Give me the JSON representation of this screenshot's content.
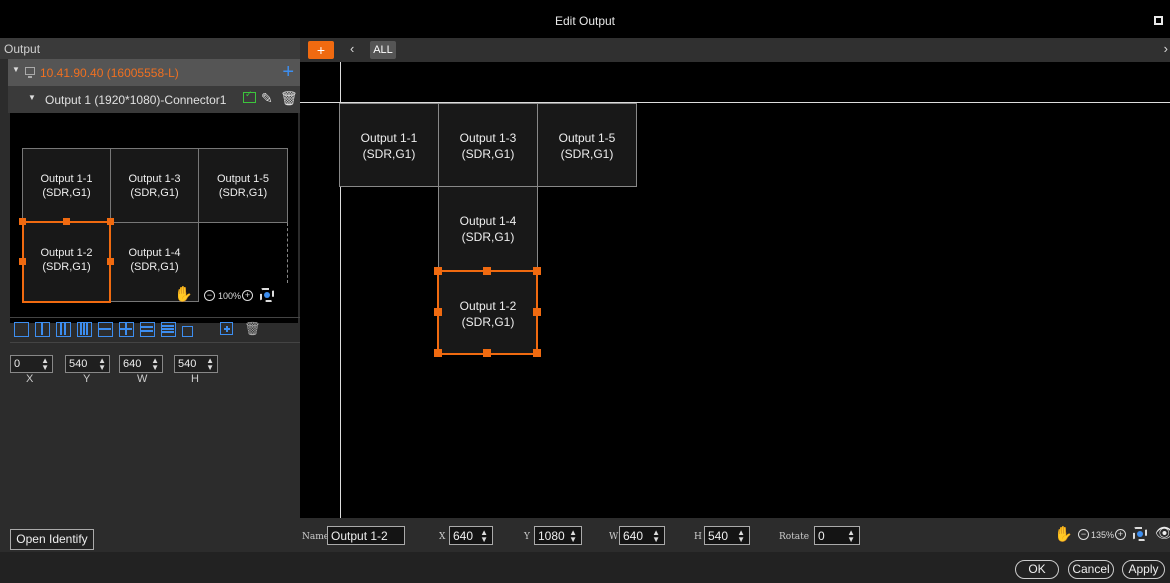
{
  "window": {
    "title": "Edit Output"
  },
  "left_panel": {
    "header": "Output",
    "device": {
      "label": "10.41.90.40  (16005558-L)"
    },
    "output": {
      "label": "Output 1 (1920*1080)-Connector1"
    },
    "preview_cells": [
      {
        "name": "Output 1-1",
        "sub": "(SDR,G1)"
      },
      {
        "name": "Output 1-3",
        "sub": "(SDR,G1)"
      },
      {
        "name": "Output 1-5",
        "sub": "(SDR,G1)"
      },
      {
        "name": "Output 1-2",
        "sub": "(SDR,G1)"
      },
      {
        "name": "Output 1-4",
        "sub": "(SDR,G1)"
      }
    ],
    "preview_zoom": "100%",
    "coords": {
      "x": "0",
      "y": "540",
      "w": "640",
      "h": "540",
      "x_label": "X",
      "y_label": "Y",
      "w_label": "W",
      "h_label": "H"
    },
    "open_identify": "Open Identify"
  },
  "canvas": {
    "add_label": "+",
    "all_label": "ALL",
    "cells": [
      {
        "name": "Output 1-1",
        "sub": "(SDR,G1)"
      },
      {
        "name": "Output 1-3",
        "sub": "(SDR,G1)"
      },
      {
        "name": "Output 1-5",
        "sub": "(SDR,G1)"
      },
      {
        "name": "Output 1-4",
        "sub": "(SDR,G1)"
      },
      {
        "name": "Output 1-2",
        "sub": "(SDR,G1)"
      }
    ],
    "selected": "Output 1-2"
  },
  "props": {
    "name_label": "Name",
    "name": "Output 1-2",
    "x_label": "X",
    "x": "640",
    "y_label": "Y",
    "y": "1080",
    "w_label": "W",
    "w": "640",
    "h_label": "H",
    "h": "540",
    "rotate_label": "Rotate",
    "rotate": "0",
    "zoom": "135%"
  },
  "footer": {
    "ok": "OK",
    "cancel": "Cancel",
    "apply": "Apply"
  },
  "colors": {
    "accent": "#f06a10",
    "blue": "#3d8ef0",
    "green": "#3cc43c"
  }
}
